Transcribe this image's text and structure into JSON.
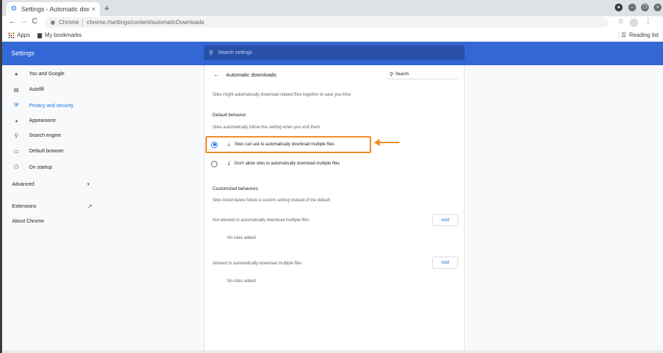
{
  "tab": {
    "title": "Settings - Automatic dow",
    "close": "×",
    "new_tab": "+"
  },
  "window_controls": [
    "●",
    "–",
    "❐",
    "×"
  ],
  "toolbar": {
    "back": "←",
    "forward": "→",
    "reload": "C",
    "chip": "Chrome",
    "url": "chrome://settings/content/automaticDownloads",
    "star": "☆",
    "menu": "⋮"
  },
  "bookmarks": {
    "apps": "Apps",
    "my_bookmarks": "My bookmarks",
    "reading_list": "Reading list"
  },
  "header": {
    "title": "Settings",
    "search_placeholder": "Search settings"
  },
  "sidebar": {
    "items": [
      {
        "label": "You and Google",
        "icon": "person-icon"
      },
      {
        "label": "Autofill",
        "icon": "clipboard-icon"
      },
      {
        "label": "Privacy and security",
        "icon": "shield-icon"
      },
      {
        "label": "Appearance",
        "icon": "palette-icon"
      },
      {
        "label": "Search engine",
        "icon": "search-icon"
      },
      {
        "label": "Default browser",
        "icon": "browser-icon"
      },
      {
        "label": "On startup",
        "icon": "power-icon"
      }
    ],
    "advanced": "Advanced",
    "advanced_arrow": "▾",
    "extensions": "Extensions",
    "about": "About Chrome"
  },
  "page": {
    "title": "Automatic downloads",
    "search_label": "Search",
    "description": "Sites might automatically download related files together to save you time",
    "default_behavior": {
      "heading": "Default behavior",
      "sub": "Sites automatically follow this setting when you visit them",
      "options": [
        {
          "label": "Sites can ask to automatically download multiple files",
          "checked": true
        },
        {
          "label": "Don't allow sites to automatically download multiple files",
          "checked": false
        }
      ]
    },
    "customized": {
      "heading": "Customized behaviors",
      "sub": "Sites listed below follow a custom setting instead of the default",
      "not_allowed": {
        "label": "Not allowed to automatically download multiple files",
        "add": "Add",
        "empty": "No sites added"
      },
      "allowed": {
        "label": "Allowed to automatically download multiple files",
        "add": "Add",
        "empty": "No sites added"
      }
    }
  },
  "colors": {
    "header": "#3367d6",
    "accent": "#1a73e8",
    "annotation": "#f08a24"
  }
}
